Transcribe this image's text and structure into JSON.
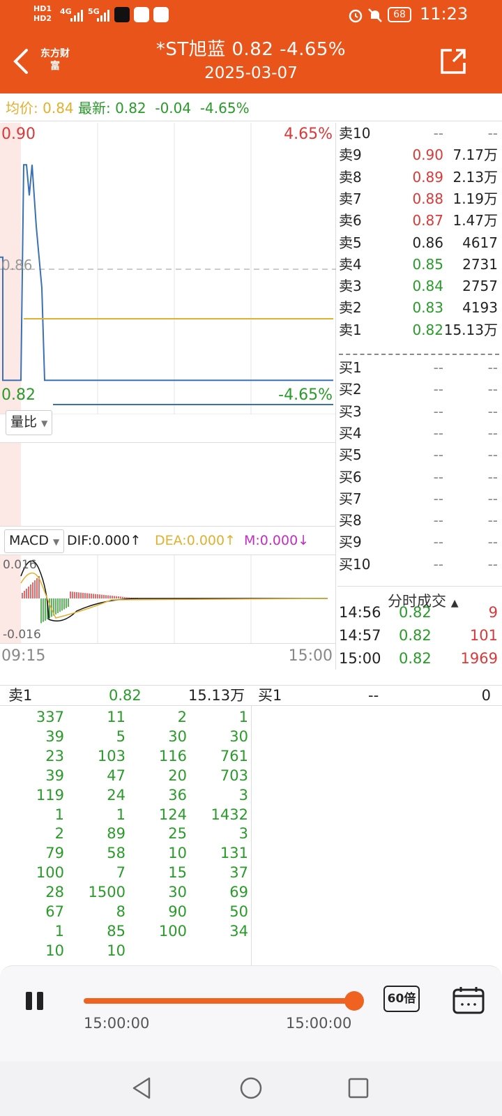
{
  "status_bar": {
    "left_items": [
      "HD1",
      "HD2",
      "4G",
      "5G"
    ],
    "battery": "68",
    "time": "11:23"
  },
  "header": {
    "logo_text": "东方财富",
    "title": "*ST旭蓝  0.82  -4.65%",
    "date": "2025-03-07",
    "colors": {
      "background": "#E9541B"
    }
  },
  "info_bar": {
    "avg_label": "均价:",
    "avg_value": "0.84",
    "latest_label": "最新:",
    "latest_value": "0.82",
    "change": "-0.04",
    "change_pct": "-4.65%"
  },
  "price_chart": {
    "top_price": "0.90",
    "mid_price": "0.86",
    "bottom_price": "0.82",
    "top_pct": "4.65%",
    "bottom_pct": "-4.65%",
    "x_start": "09:15",
    "x_end": "15:00"
  },
  "chart_data": [
    {
      "type": "line",
      "title": "",
      "ylim": [
        0.78,
        0.9
      ],
      "series": [
        {
          "color": "#3A70B4",
          "values": [
            0.86,
            0.86,
            0.82,
            0.82,
            0.89,
            0.89,
            0.88,
            0.89,
            0.87,
            0.86,
            0.85,
            0.82,
            0.82,
            0.82,
            0.82
          ]
        },
        {
          "color": "#E0B030",
          "values": [
            0.84,
            0.84,
            0.84,
            0.84,
            0.84,
            0.84,
            0.84,
            0.84
          ]
        }
      ]
    }
  ],
  "volume_panel": {
    "selector_label": "量比"
  },
  "macd": {
    "selector_label": "MACD",
    "dif": "DIF:0.000↑",
    "dea": "DEA:0.000↑",
    "m": "M:0.000↓",
    "top_label": "0.016",
    "bottom_label": "-0.016"
  },
  "orderbook": {
    "sells": [
      {
        "label": "卖10",
        "price": "--",
        "volume": "--",
        "color": "#888888"
      },
      {
        "label": "卖9",
        "price": "0.90",
        "volume": "7.17万",
        "color": "#D83A3A"
      },
      {
        "label": "卖8",
        "price": "0.89",
        "volume": "2.13万",
        "color": "#D83A3A"
      },
      {
        "label": "卖7",
        "price": "0.88",
        "volume": "1.19万",
        "color": "#D83A3A"
      },
      {
        "label": "卖6",
        "price": "0.87",
        "volume": "1.47万",
        "color": "#D83A3A"
      },
      {
        "label": "卖5",
        "price": "0.86",
        "volume": "4617",
        "color": "#222222"
      },
      {
        "label": "卖4",
        "price": "0.85",
        "volume": "2731",
        "color": "#2A9A2A"
      },
      {
        "label": "卖3",
        "price": "0.84",
        "volume": "2757",
        "color": "#2A9A2A"
      },
      {
        "label": "卖2",
        "price": "0.83",
        "volume": "4193",
        "color": "#2A9A2A"
      },
      {
        "label": "卖1",
        "price": "0.82",
        "volume": "15.13万",
        "color": "#2A9A2A"
      }
    ],
    "buys": [
      {
        "label": "买1",
        "price": "--",
        "volume": "--"
      },
      {
        "label": "买2",
        "price": "--",
        "volume": "--"
      },
      {
        "label": "买3",
        "price": "--",
        "volume": "--"
      },
      {
        "label": "买4",
        "price": "--",
        "volume": "--"
      },
      {
        "label": "买5",
        "price": "--",
        "volume": "--"
      },
      {
        "label": "买6",
        "price": "--",
        "volume": "--"
      },
      {
        "label": "买7",
        "price": "--",
        "volume": "--"
      },
      {
        "label": "买8",
        "price": "--",
        "volume": "--"
      },
      {
        "label": "买9",
        "price": "--",
        "volume": "--"
      },
      {
        "label": "买10",
        "price": "--",
        "volume": "--"
      }
    ]
  },
  "trades": {
    "header": "分时成交",
    "rows": [
      {
        "time": "14:56",
        "price": "0.82",
        "volume": "9"
      },
      {
        "time": "14:57",
        "price": "0.82",
        "volume": "101"
      },
      {
        "time": "15:00",
        "price": "0.82",
        "volume": "1969"
      }
    ]
  },
  "bottom_table": {
    "sell_label": "卖1",
    "sell_price": "0.82",
    "sell_volume": "15.13万",
    "buy_label": "买1",
    "buy_price": "--",
    "buy_volume": "0",
    "queue": [
      [
        "337",
        "11",
        "2",
        "1"
      ],
      [
        "39",
        "5",
        "30",
        "30"
      ],
      [
        "23",
        "103",
        "116",
        "761"
      ],
      [
        "39",
        "47",
        "20",
        "703"
      ],
      [
        "119",
        "24",
        "36",
        "3"
      ],
      [
        "1",
        "1",
        "124",
        "1432"
      ],
      [
        "2",
        "89",
        "25",
        "3"
      ],
      [
        "79",
        "58",
        "10",
        "131"
      ],
      [
        "100",
        "7",
        "15",
        "37"
      ],
      [
        "28",
        "1500",
        "30",
        "69"
      ],
      [
        "67",
        "8",
        "90",
        "50"
      ],
      [
        "1",
        "85",
        "100",
        "34"
      ],
      [
        "10",
        "10",
        "",
        ""
      ]
    ]
  },
  "playback": {
    "start_time": "15:00:00",
    "end_time": "15:00:00",
    "speed": "60倍",
    "progress": 1.0
  }
}
